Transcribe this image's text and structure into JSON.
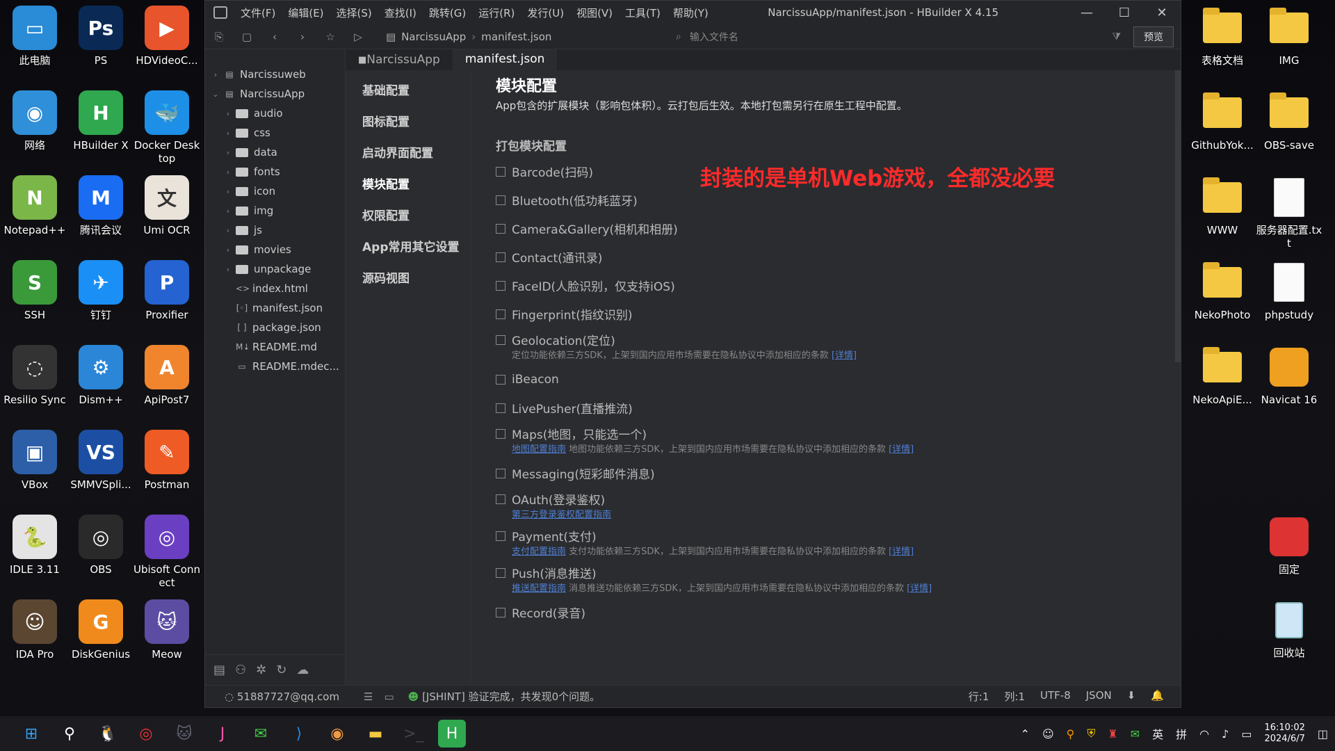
{
  "desktop_left": [
    {
      "label": "此电脑",
      "color": "#2a8bd6",
      "glyph": "▭"
    },
    {
      "label": "PS",
      "color": "#0a2a55",
      "glyph": "Ps"
    },
    {
      "label": "HDVideoC...",
      "color": "#e8542c",
      "glyph": "▶"
    },
    {
      "label": "网络",
      "color": "#2f8fd8",
      "glyph": "◉"
    },
    {
      "label": "HBuilder X",
      "color": "#2fa84f",
      "glyph": "H"
    },
    {
      "label": "Docker Desktop",
      "color": "#1d8fe6",
      "glyph": "🐳"
    },
    {
      "label": "Notepad++",
      "color": "#7ab648",
      "glyph": "N"
    },
    {
      "label": "腾讯会议",
      "color": "#1a6cf3",
      "glyph": "M"
    },
    {
      "label": "Umi OCR",
      "color": "#e9e3da",
      "glyph": "文"
    },
    {
      "label": "SSH",
      "color": "#3a9a3a",
      "glyph": "S"
    },
    {
      "label": "钉钉",
      "color": "#1a8ff5",
      "glyph": "✈"
    },
    {
      "label": "Proxifier",
      "color": "#2463d1",
      "glyph": "P"
    },
    {
      "label": "Resilio Sync",
      "color": "#333",
      "glyph": "◌"
    },
    {
      "label": "Dism++",
      "color": "#2b86d8",
      "glyph": "⚙"
    },
    {
      "label": "ApiPost7",
      "color": "#f0852d",
      "glyph": "A"
    },
    {
      "label": "VBox",
      "color": "#2c5fa8",
      "glyph": "▣"
    },
    {
      "label": "SMMVSpli...",
      "color": "#1c4fa4",
      "glyph": "VS"
    },
    {
      "label": "Postman",
      "color": "#ef5b25",
      "glyph": "✎"
    },
    {
      "label": "IDLE 3.11",
      "color": "#e4e4e4",
      "glyph": "🐍"
    },
    {
      "label": "OBS",
      "color": "#2a2a2a",
      "glyph": "◎"
    },
    {
      "label": "Ubisoft Connect",
      "color": "#6b3fc2",
      "glyph": "◎"
    },
    {
      "label": "IDA Pro",
      "color": "#5b4632",
      "glyph": "☺"
    },
    {
      "label": "DiskGenius",
      "color": "#f08a1c",
      "glyph": "G"
    },
    {
      "label": "Meow",
      "color": "#5c4da3",
      "glyph": "🐱"
    }
  ],
  "desktop_right": [
    {
      "label": "表格文档",
      "type": "folder"
    },
    {
      "label": "IMG",
      "type": "folder"
    },
    {
      "label": "GithubYok...",
      "type": "folder"
    },
    {
      "label": "OBS-save",
      "type": "folder"
    },
    {
      "label": "WWW",
      "type": "folder"
    },
    {
      "label": "服务器配置.txt",
      "type": "doc"
    },
    {
      "label": "NekoPhoto",
      "type": "folder"
    },
    {
      "label": "phpstudy",
      "type": "doc"
    },
    {
      "label": "NekoApiE...",
      "type": "folder"
    },
    {
      "label": "Navicat 16",
      "type": "app"
    },
    {
      "label": "固定",
      "type": "app"
    },
    {
      "label": "回收站",
      "type": "bin"
    }
  ],
  "window": {
    "title": "NarcissuApp/manifest.json - HBuilder X 4.15",
    "menu": [
      "文件(F)",
      "编辑(E)",
      "选择(S)",
      "查找(I)",
      "跳转(G)",
      "运行(R)",
      "发行(U)",
      "视图(V)",
      "工具(T)",
      "帮助(Y)"
    ],
    "breadcrumb": [
      "NarcissuApp",
      "manifest.json"
    ],
    "search_placeholder": "输入文件名",
    "preview_label": "预览"
  },
  "tree": [
    {
      "label": "Narcissuweb",
      "type": "project",
      "level": 0,
      "arrow": "›"
    },
    {
      "label": "NarcissuApp",
      "type": "project",
      "level": 0,
      "arrow": "⌄"
    },
    {
      "label": "audio",
      "type": "folder",
      "level": 1,
      "arrow": "›"
    },
    {
      "label": "css",
      "type": "folder",
      "level": 1,
      "arrow": "›"
    },
    {
      "label": "data",
      "type": "folder",
      "level": 1,
      "arrow": "›"
    },
    {
      "label": "fonts",
      "type": "folder",
      "level": 1,
      "arrow": "›"
    },
    {
      "label": "icon",
      "type": "folder",
      "level": 1,
      "arrow": "›"
    },
    {
      "label": "img",
      "type": "folder",
      "level": 1,
      "arrow": "›"
    },
    {
      "label": "js",
      "type": "folder",
      "level": 1,
      "arrow": "›"
    },
    {
      "label": "movies",
      "type": "folder",
      "level": 1,
      "arrow": "›"
    },
    {
      "label": "unpackage",
      "type": "folder",
      "level": 1,
      "arrow": "›"
    },
    {
      "label": "index.html",
      "type": "file",
      "glyph": "<>",
      "level": 1
    },
    {
      "label": "manifest.json",
      "type": "file",
      "glyph": "[◦]",
      "level": 1
    },
    {
      "label": "package.json",
      "type": "file",
      "glyph": "[ ]",
      "level": 1
    },
    {
      "label": "README.md",
      "type": "file",
      "glyph": "M↓",
      "level": 1
    },
    {
      "label": "README.mdec...",
      "type": "file",
      "glyph": "▭",
      "level": 1
    }
  ],
  "tabs": [
    {
      "label": "NarcissuApp",
      "active": false
    },
    {
      "label": "manifest.json",
      "active": true
    }
  ],
  "nav": [
    "基础配置",
    "图标配置",
    "启动界面配置",
    "模块配置",
    "权限配置",
    "App常用其它设置",
    "源码视图"
  ],
  "nav_active": 3,
  "form": {
    "title": "模块配置",
    "desc": "App包含的扩展模块（影响包体积）。云打包后生效。本地打包需另行在原生工程中配置。",
    "section": "打包模块配置",
    "annotation": "封装的是单机Web游戏，全都没必要",
    "options": [
      {
        "label": "Barcode(扫码)"
      },
      {
        "label": "Bluetooth(低功耗蓝牙)"
      },
      {
        "label": "Camera&Gallery(相机和相册)"
      },
      {
        "label": "Contact(通讯录)"
      },
      {
        "label": "FaceID(人脸识别，仅支持iOS)"
      },
      {
        "label": "Fingerprint(指纹识别)"
      },
      {
        "label": "Geolocation(定位)",
        "note": "定位功能依赖三方SDK，上架到国内应用市场需要在隐私协议中添加相应的条款",
        "link2": "[详情]"
      },
      {
        "label": "iBeacon"
      },
      {
        "label": "LivePusher(直播推流)"
      },
      {
        "label": "Maps(地图，只能选一个)",
        "link": "地图配置指南",
        "note": "地图功能依赖三方SDK，上架到国内应用市场需要在隐私协议中添加相应的条款",
        "link2": "[详情]"
      },
      {
        "label": "Messaging(短彩邮件消息)"
      },
      {
        "label": "OAuth(登录鉴权)",
        "link": "第三方登录鉴权配置指南"
      },
      {
        "label": "Payment(支付)",
        "link": "支付配置指南",
        "note": "支付功能依赖三方SDK，上架到国内应用市场需要在隐私协议中添加相应的条款",
        "link2": "[详情]"
      },
      {
        "label": "Push(消息推送)",
        "link": "推送配置指南",
        "note": "消息推送功能依赖三方SDK，上架到国内应用市场需要在隐私协议中添加相应的条款",
        "link2": "[详情]"
      },
      {
        "label": "Record(录音)"
      }
    ]
  },
  "statusbar": {
    "account": "51887727@qq.com",
    "message": "[JSHINT] 验证完成，共发现0个问题。",
    "line": "行:1",
    "col": "列:1",
    "encoding": "UTF-8",
    "lang": "JSON"
  },
  "taskbar": {
    "apps": [
      "start",
      "search",
      "qq",
      "netease",
      "cat",
      "jetbrains",
      "wechat",
      "vscode",
      "chrome",
      "explorer",
      "terminal",
      "hbuilder"
    ],
    "ime": "英",
    "ime2": "拼",
    "time": "16:10:02",
    "date": "2024/6/7"
  }
}
